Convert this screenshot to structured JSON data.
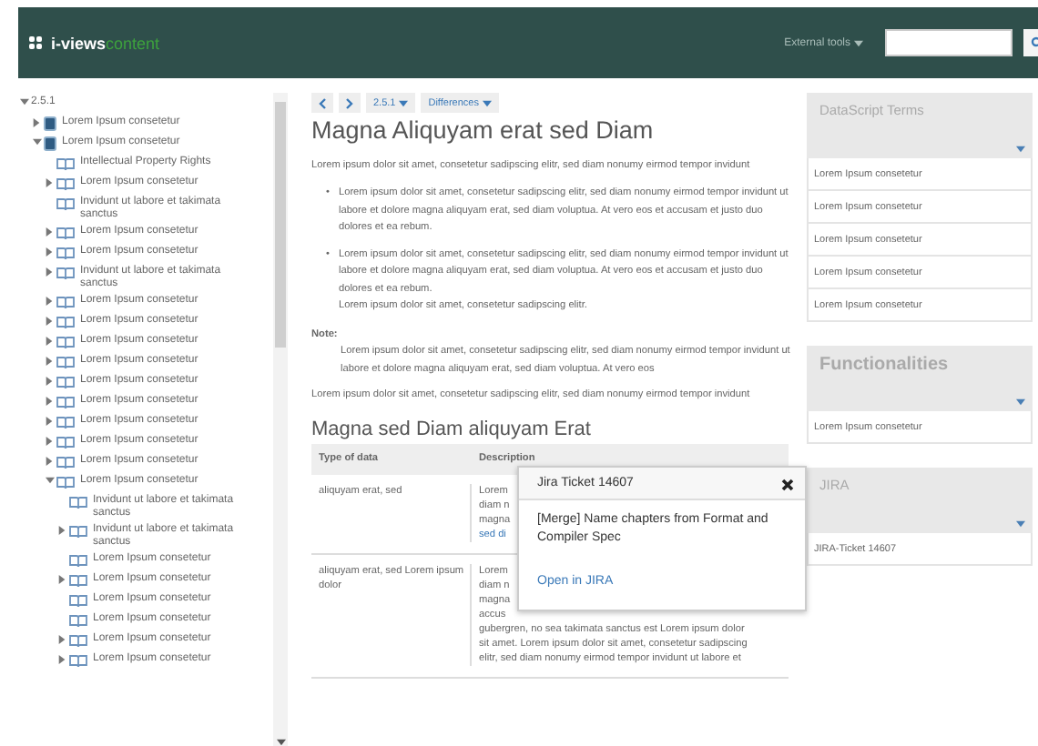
{
  "header": {
    "brand": "i-views",
    "brand_suffix": "content",
    "menu": "External tools"
  },
  "tree": [
    {
      "label": "2.5.1",
      "expanded": true,
      "children": [
        {
          "label": "Lorem Ipsum consetetur",
          "kind": "chapter",
          "expanded": false
        },
        {
          "label": "Lorem Ipsum consetetur",
          "kind": "chapter",
          "expanded": true,
          "children": [
            {
              "label": "Intellectual Property Rights",
              "kind": "page"
            },
            {
              "label": "Lorem Ipsum consetetur",
              "kind": "page",
              "expanded": false
            },
            {
              "label": "Invidunt ut labore et takimata sanctus",
              "kind": "page"
            },
            {
              "label": "Lorem Ipsum consetetur",
              "kind": "page",
              "expanded": false
            },
            {
              "label": "Lorem Ipsum consetetur",
              "kind": "page",
              "expanded": false
            },
            {
              "label": "Invidunt ut labore et takimata sanctus",
              "kind": "page",
              "expanded": false
            },
            {
              "label": "Lorem Ipsum consetetur",
              "kind": "page",
              "expanded": false
            },
            {
              "label": "Lorem Ipsum consetetur",
              "kind": "page",
              "expanded": false
            },
            {
              "label": "Lorem Ipsum consetetur",
              "kind": "page",
              "expanded": false
            },
            {
              "label": "Lorem Ipsum consetetur",
              "kind": "page",
              "expanded": false
            },
            {
              "label": "Lorem Ipsum consetetur",
              "kind": "page",
              "expanded": false
            },
            {
              "label": "Lorem Ipsum consetetur",
              "kind": "page",
              "expanded": false
            },
            {
              "label": "Lorem Ipsum consetetur",
              "kind": "page",
              "expanded": false
            },
            {
              "label": "Lorem Ipsum consetetur",
              "kind": "page",
              "expanded": false
            },
            {
              "label": "Lorem Ipsum consetetur",
              "kind": "page",
              "expanded": false
            },
            {
              "label": "Lorem Ipsum consetetur",
              "kind": "page",
              "expanded": true,
              "children": [
                {
                  "label": "Invidunt ut labore et takimata sanctus",
                  "kind": "page"
                },
                {
                  "label": "Invidunt ut labore et takimata sanctus",
                  "kind": "page",
                  "expanded": false
                },
                {
                  "label": "Lorem Ipsum consetetur",
                  "kind": "page"
                },
                {
                  "label": "Lorem Ipsum consetetur",
                  "kind": "page",
                  "expanded": false
                },
                {
                  "label": "Lorem Ipsum consetetur",
                  "kind": "page"
                },
                {
                  "label": "Lorem Ipsum consetetur",
                  "kind": "page"
                },
                {
                  "label": "Lorem Ipsum consetetur",
                  "kind": "page",
                  "expanded": false
                },
                {
                  "label": "Lorem Ipsum consetetur",
                  "kind": "page",
                  "expanded": false
                }
              ]
            }
          ]
        }
      ]
    }
  ],
  "toolbar": [
    {
      "kind": "prev"
    },
    {
      "kind": "next"
    },
    {
      "kind": "dropdown",
      "label": "2.5.1"
    },
    {
      "kind": "dropdown",
      "label": "Differences"
    }
  ],
  "content": {
    "title": "Magna Aliquyam erat sed Diam",
    "blocks": [
      {
        "kind": "paragraph",
        "text": "Lorem ipsum dolor sit amet, consetetur sadipscing elitr, sed diam nonumy eirmod tempor invidunt"
      },
      {
        "kind": "bullets",
        "items": [
          {
            "marker": "•",
            "lines": [
              "Lorem ipsum dolor sit amet, consetetur sadipscing elitr, sed diam nonumy eirmod tempor invidunt ut labore et dolore magna aliquyam erat, sed diam voluptua. At vero eos et accusam et justo duo dolores et ea rebum."
            ]
          },
          {
            "marker": "•",
            "lines": [
              "Lorem ipsum dolor sit amet, consetetur sadipscing elitr, sed diam nonumy eirmod tempor invidunt ut labore et dolore magna aliquyam erat, sed diam voluptua. At vero eos et accusam et justo duo dolores et ea rebum.",
              "Lorem ipsum dolor sit amet, consetetur sadipscing elitr."
            ]
          }
        ]
      },
      {
        "kind": "note",
        "label": "Note:",
        "text": "Lorem ipsum dolor sit amet, consetetur sadipscing elitr, sed diam nonumy eirmod tempor invidunt ut labore et dolore magna aliquyam erat, sed diam voluptua. At vero eos"
      },
      {
        "kind": "paragraph",
        "text": "Lorem ipsum dolor sit amet, consetetur sadipscing elitr, sed diam nonumy eirmod tempor invidunt"
      }
    ],
    "subtitle": "Magna sed Diam aliquyam Erat",
    "table": {
      "columns": [
        "Type of data",
        "Description"
      ],
      "rows": [
        {
          "type": "aliquyam erat, sed",
          "lines": [
            {
              "text": "Lorem"
            },
            {
              "text": "diam n"
            },
            {
              "text": "magna"
            },
            {
              "text": "sed di",
              "link": true
            }
          ]
        },
        {
          "type": "aliquyam erat, sed Lorem ipsum dolor",
          "lines": [
            {
              "text": "Lorem"
            },
            {
              "text": "diam n"
            },
            {
              "text": "magna"
            },
            {
              "text": "accus"
            },
            {
              "text": "gubergren, no sea takimata sanctus est Lorem ipsum dolor"
            },
            {
              "text": "sit amet. Lorem ipsum dolor sit amet, consetetur sadipscing"
            },
            {
              "text": "elitr, sed diam nonumy eirmod tempor invidunt ut labore et"
            }
          ]
        }
      ]
    },
    "popup": {
      "title": "Jira Ticket 14607",
      "text": "[Merge] Name chapters from Format and Compiler Spec",
      "link": "Open in JIRA"
    }
  },
  "panels": [
    {
      "title": "DataScript Terms",
      "items": [
        "Lorem Ipsum consetetur",
        "Lorem Ipsum consetetur",
        "Lorem Ipsum consetetur",
        "Lorem Ipsum consetetur",
        "Lorem Ipsum consetetur"
      ]
    },
    {
      "title": "Functionalities",
      "items": [
        "Lorem Ipsum consetetur"
      ]
    },
    {
      "title": "JIRA",
      "items": [
        "JIRA-Ticket 14607"
      ]
    }
  ]
}
